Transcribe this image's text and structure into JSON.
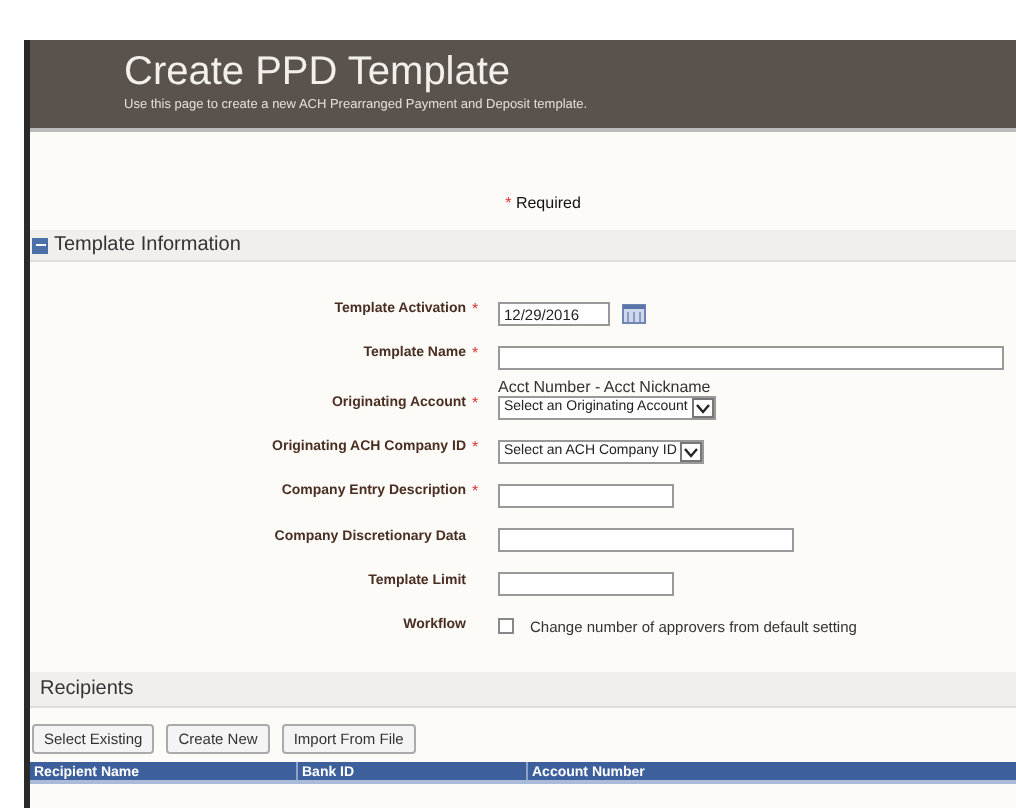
{
  "header": {
    "title": "Create PPD Template",
    "subtitle": "Use this page to create a new ACH Prearranged Payment and Deposit template."
  },
  "required_note": {
    "mark": "*",
    "text": "Required"
  },
  "template_information": {
    "title": "Template Information",
    "expanded": true,
    "fields": [
      {
        "kind": "date",
        "label": "Template Activation",
        "required": true,
        "value": "12/29/2016"
      },
      {
        "kind": "text",
        "label": "Template Name",
        "required": true
      },
      {
        "kind": "select",
        "label": "Originating Account",
        "required": true,
        "hint": "Acct Number - Acct Nickname",
        "value": "Select an Originating Account"
      },
      {
        "kind": "select",
        "label": "Originating ACH Company ID",
        "required": true,
        "value": "Select an ACH Company ID"
      },
      {
        "kind": "text",
        "label": "Company Entry Description",
        "required": true
      },
      {
        "kind": "text",
        "label": "Company Discretionary Data",
        "required": false
      },
      {
        "kind": "text",
        "label": "Template Limit",
        "required": false
      },
      {
        "kind": "checkbox",
        "label": "Workflow",
        "required": false,
        "checked": false,
        "text": "Change number of approvers from default setting"
      }
    ]
  },
  "recipients": {
    "title": "Recipients",
    "buttons": [
      "Select Existing",
      "Create New",
      "Import From File"
    ],
    "table": {
      "columns": [
        "Recipient Name",
        "Bank ID",
        "Account Number"
      ]
    }
  }
}
